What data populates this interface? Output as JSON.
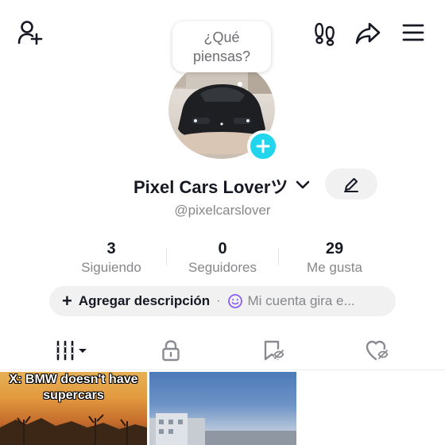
{
  "header": {
    "add_friend_icon": "person-add-icon",
    "footprints_icon": "footprints-icon",
    "share_icon": "share-icon",
    "menu_icon": "hamburger-menu-icon"
  },
  "thought_bubble": {
    "text": "¿Qué piensas?"
  },
  "profile": {
    "display_name": "Pixel Cars Loverツ",
    "handle": "@pixelcarslover",
    "add_avatar_icon": "plus-icon",
    "edit_icon": "pencil-icon"
  },
  "stats": [
    {
      "value": "3",
      "label": "Siguiendo"
    },
    {
      "value": "0",
      "label": "Seguidores"
    },
    {
      "value": "29",
      "label": "Me gusta"
    }
  ],
  "description": {
    "add_label": "Agregar descripción",
    "separator": "·",
    "bio_preview": "Mi cuenta gira e..."
  },
  "tabs": [
    {
      "name": "videos",
      "icon": "grid-columns-icon"
    },
    {
      "name": "private",
      "icon": "lock-icon"
    },
    {
      "name": "favorites",
      "icon": "bookmark-hidden-icon"
    },
    {
      "name": "liked",
      "icon": "heart-hidden-icon"
    }
  ],
  "videos": [
    {
      "caption": "X: BMW doesn't have supercars"
    },
    {
      "caption": ""
    }
  ],
  "colors": {
    "accent": "#20d5ec",
    "text": "#161823",
    "muted": "#86878b",
    "pill_bg": "#f1f1f2"
  }
}
